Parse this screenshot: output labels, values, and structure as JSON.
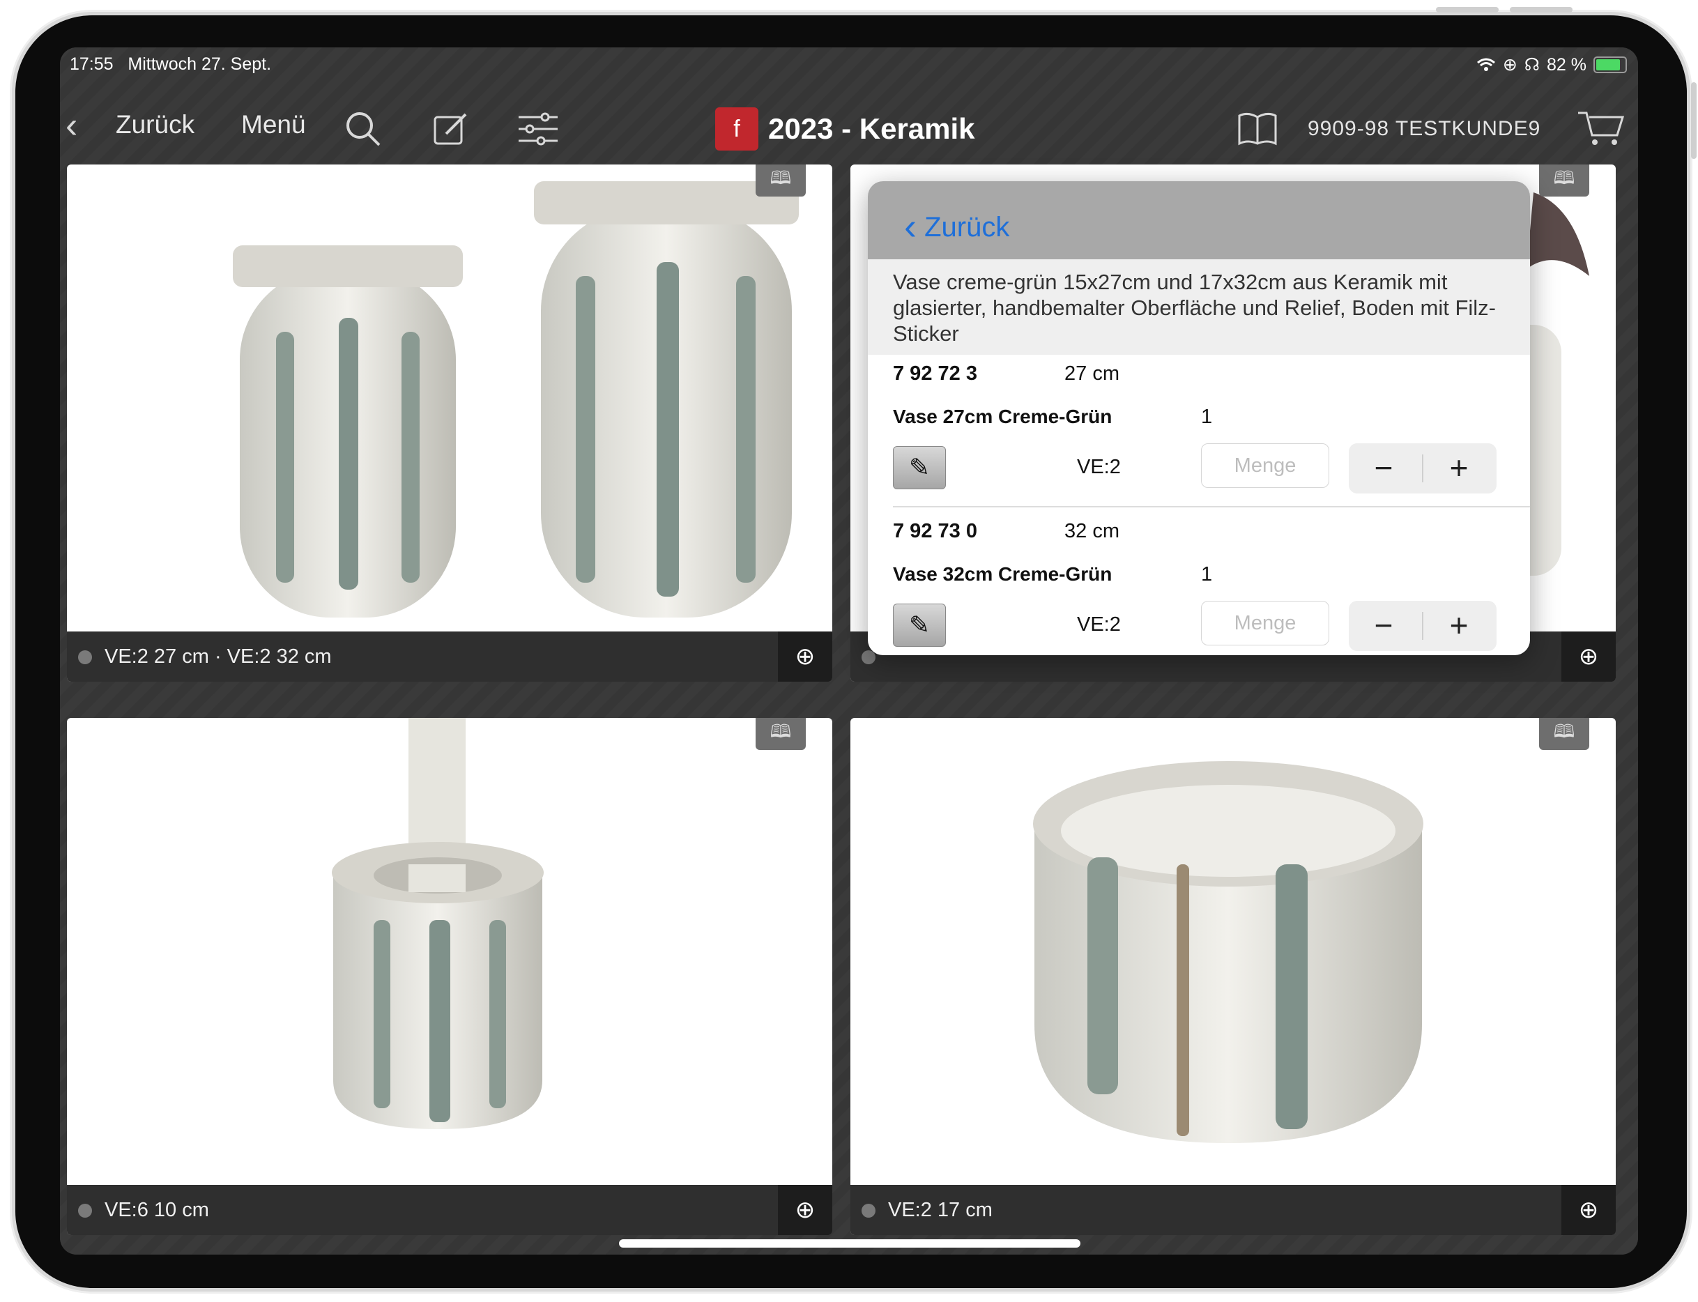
{
  "status": {
    "time": "17:55",
    "date": "Mittwoch 27. Sept.",
    "battery": "82 %"
  },
  "nav": {
    "back_label": "Zurück",
    "menu_label": "Menü",
    "title": "2023 - Keramik",
    "customer": "9909-98 TESTKUNDE9",
    "logo_text": "f"
  },
  "tiles": [
    {
      "label": "VE:2  27 cm · VE:2  32 cm"
    },
    {
      "label": ""
    },
    {
      "label": "VE:6  10 cm"
    },
    {
      "label": "VE:2  17 cm"
    }
  ],
  "popover": {
    "back_label": "Zurück",
    "description": "Vase creme-grün 15x27cm und 17x32cm aus Keramik mit glasierter, handbemalter Oberfläche und Relief, Boden mit Filz-Sticker",
    "products": [
      {
        "number": "7 92 72 3",
        "size": "27 cm",
        "name": "Vase 27cm Creme-Grün",
        "qty": "1",
        "ve": "VE:2",
        "placeholder": "Menge"
      },
      {
        "number": "7 92 73 0",
        "size": "32 cm",
        "name": "Vase 32cm Creme-Grün",
        "qty": "1",
        "ve": "VE:2",
        "placeholder": "Menge"
      }
    ]
  },
  "icons": {
    "wifi": "wifi-icon",
    "lock_rotation": "orientation-lock-icon",
    "headphones": "headphones-icon",
    "battery": "battery-icon",
    "back": "chevron-left-icon",
    "search": "search-icon",
    "edit": "compose-icon",
    "filter": "sliders-icon",
    "catalog": "book-icon",
    "cart": "cart-icon",
    "zoom": "zoom-in-icon"
  },
  "colors": {
    "accent": "#1e6fd9",
    "brand": "#c1272d",
    "battery": "#4cd964"
  }
}
